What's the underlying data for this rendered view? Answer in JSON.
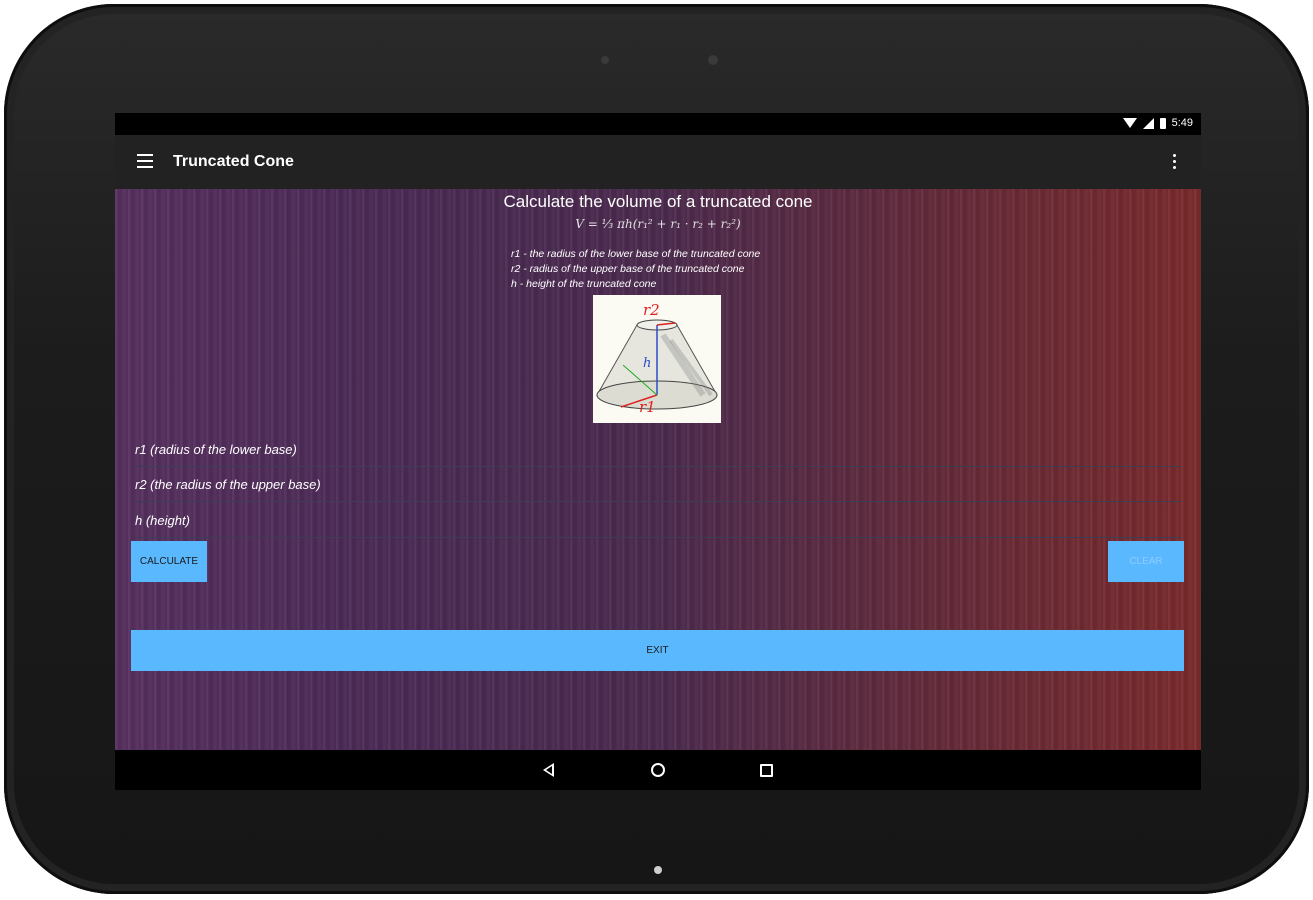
{
  "status_bar": {
    "time": "5:49"
  },
  "app_bar": {
    "title": "Truncated Cone"
  },
  "main": {
    "heading": "Calculate the volume of a truncated cone",
    "formula": "V = ⅓ πh(r₁² + r₁ · r₂ + r₂²)",
    "legend": [
      "r1 - the radius of the lower base of the truncated cone",
      "r2 - radius of the upper base of the truncated cone",
      "h - height of the truncated cone"
    ],
    "image_labels": {
      "r2": "r2",
      "h": "h",
      "r1": "r1"
    },
    "inputs": {
      "r1_placeholder": "r1 (radius of the lower base)",
      "r2_placeholder": "r2 (the radius of the upper base)",
      "h_placeholder": "h (height)"
    },
    "buttons": {
      "calculate": "CALCULATE",
      "clear": "CLEAR",
      "exit": "EXIT"
    }
  },
  "colors": {
    "button": "#5ab8ff",
    "app_bar": "#222222",
    "clear_text": "#8fcbff"
  }
}
